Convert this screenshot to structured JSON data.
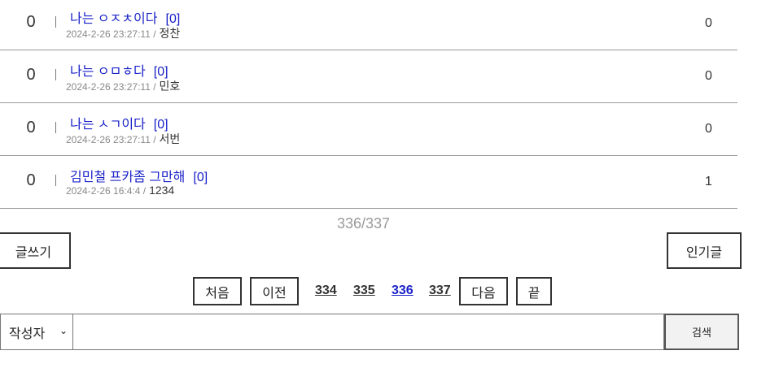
{
  "posts": [
    {
      "num": "0",
      "title": "나는 ㅇㅈㅊ이다",
      "comments": "[0]",
      "date": "2024-2-26 23:27:11 /",
      "author": "정찬",
      "views": "0"
    },
    {
      "num": "0",
      "title": "나는 ㅇㅁㅎ다",
      "comments": "[0]",
      "date": "2024-2-26 23:27:11 /",
      "author": "민호",
      "views": "0"
    },
    {
      "num": "0",
      "title": "나는 ㅅㄱ이다",
      "comments": "[0]",
      "date": "2024-2-26 23:27:11 /",
      "author": "서번",
      "views": "0"
    },
    {
      "num": "0",
      "title": "김민철 프카좀 그만해",
      "comments": "[0]",
      "date": "2024-2-26 16:4:4 /",
      "author": "1234",
      "views": "1"
    }
  ],
  "page_info": "336/337",
  "buttons": {
    "write": "글쓰기",
    "popular": "인기글"
  },
  "pagination": {
    "first": "처음",
    "prev": "이전",
    "next": "다음",
    "last": "끝",
    "pages": [
      "334",
      "335",
      "336",
      "337"
    ],
    "current": "336"
  },
  "search": {
    "field_selected": "작성자",
    "input_value": "",
    "button": "검색"
  }
}
